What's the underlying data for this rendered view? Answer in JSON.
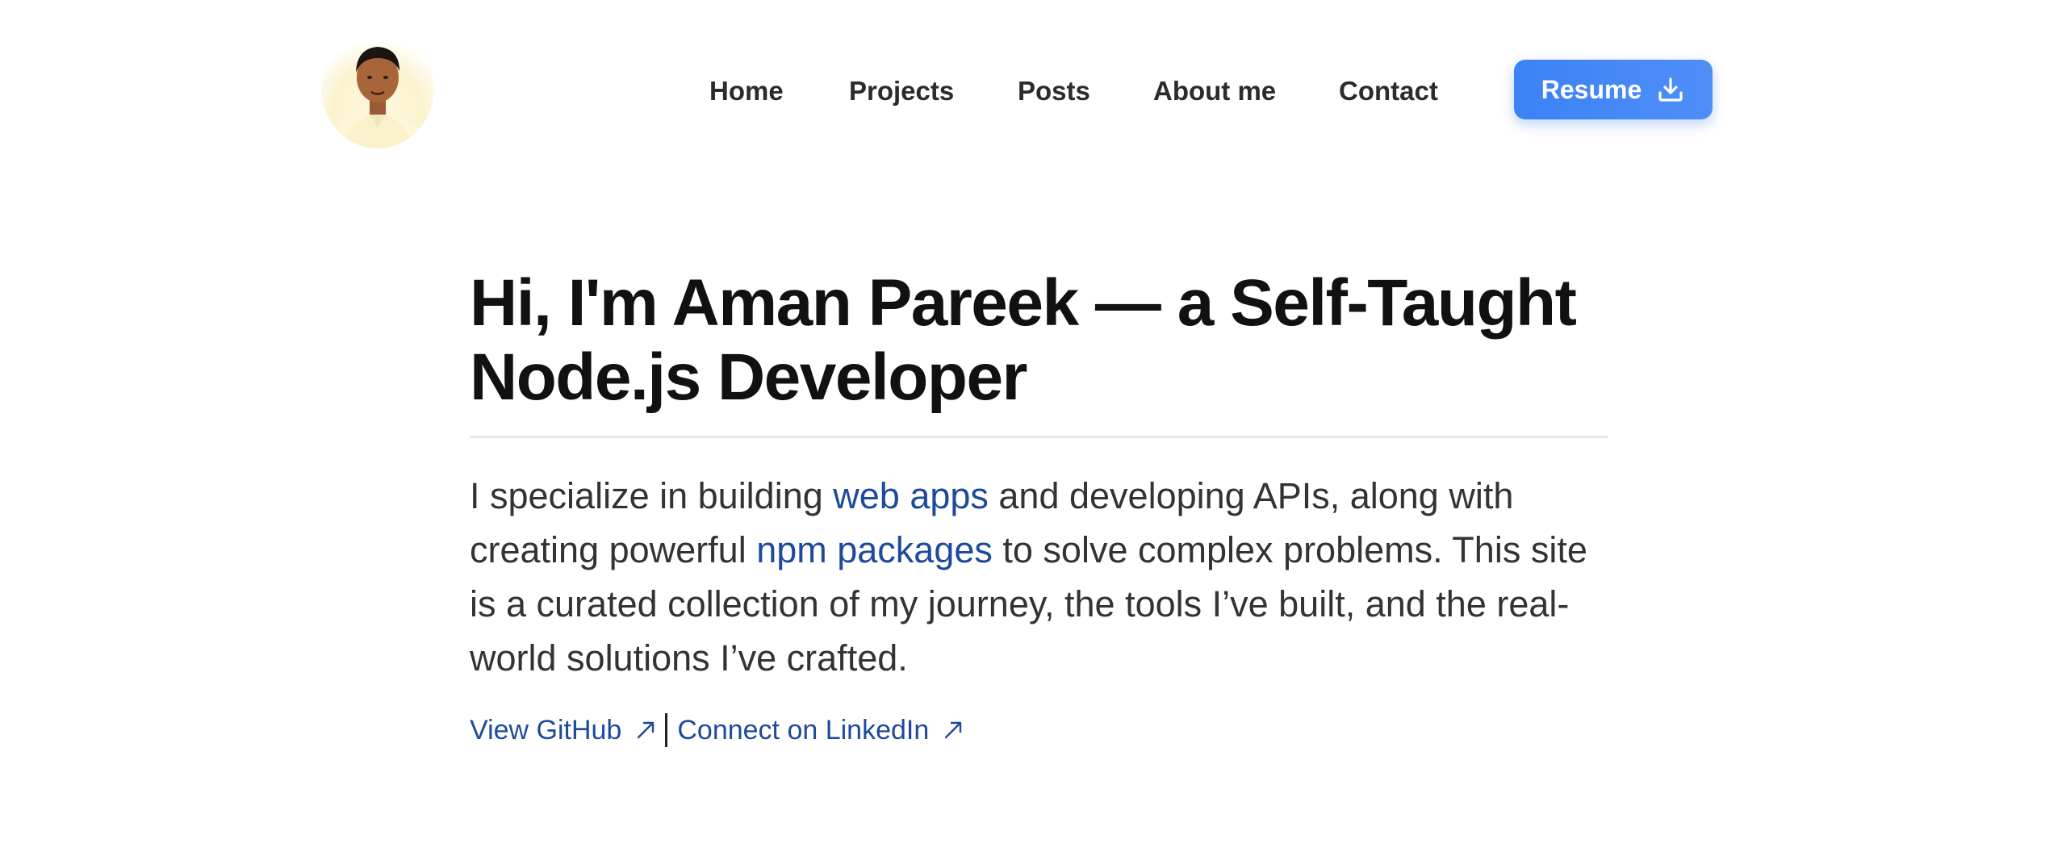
{
  "header": {
    "nav": [
      {
        "label": "Home"
      },
      {
        "label": "Projects"
      },
      {
        "label": "Posts"
      },
      {
        "label": "About me"
      },
      {
        "label": "Contact"
      }
    ],
    "resume_label": "Resume",
    "resume_icon": "download-icon",
    "avatar_icon": "avatar",
    "accent_color": "#3b82f6"
  },
  "hero": {
    "title": "Hi, I'm Aman Pareek — a Self-Taught Node.js Developer",
    "text": {
      "part1": "I specialize in building ",
      "link1": "web apps",
      "part2": " and developing APIs, along with creating powerful ",
      "link2": "npm packages",
      "part3": " to solve complex problems. This site is a curated collection of my journey, the tools I’ve built, and the real-world solutions I’ve crafted."
    },
    "link_color": "#1e4a9b",
    "social": {
      "github_label": "View GitHub",
      "linkedin_label": "Connect on LinkedIn",
      "arrow_icon": "external-arrow-icon"
    }
  }
}
